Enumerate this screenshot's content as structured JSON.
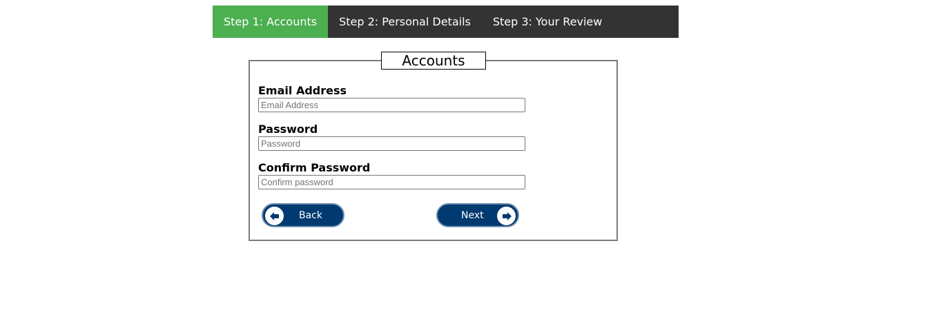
{
  "steps": [
    {
      "label": "Step 1: Accounts",
      "active": true
    },
    {
      "label": "Step 2: Personal Details",
      "active": false
    },
    {
      "label": "Step 3: Your Review",
      "active": false
    }
  ],
  "form": {
    "legend": "Accounts",
    "email": {
      "label": "Email Address",
      "placeholder": "Email Address",
      "value": ""
    },
    "password": {
      "label": "Password",
      "placeholder": "Password",
      "value": ""
    },
    "confirm": {
      "label": "Confirm Password",
      "placeholder": "Confirm password",
      "value": ""
    }
  },
  "buttons": {
    "back": {
      "label": "Back",
      "icon": "arrow-left-icon"
    },
    "next": {
      "label": "Next",
      "icon": "arrow-right-icon"
    }
  },
  "colors": {
    "active_step": "#4caf50",
    "step_bar": "#333333",
    "button": "#003a70"
  }
}
